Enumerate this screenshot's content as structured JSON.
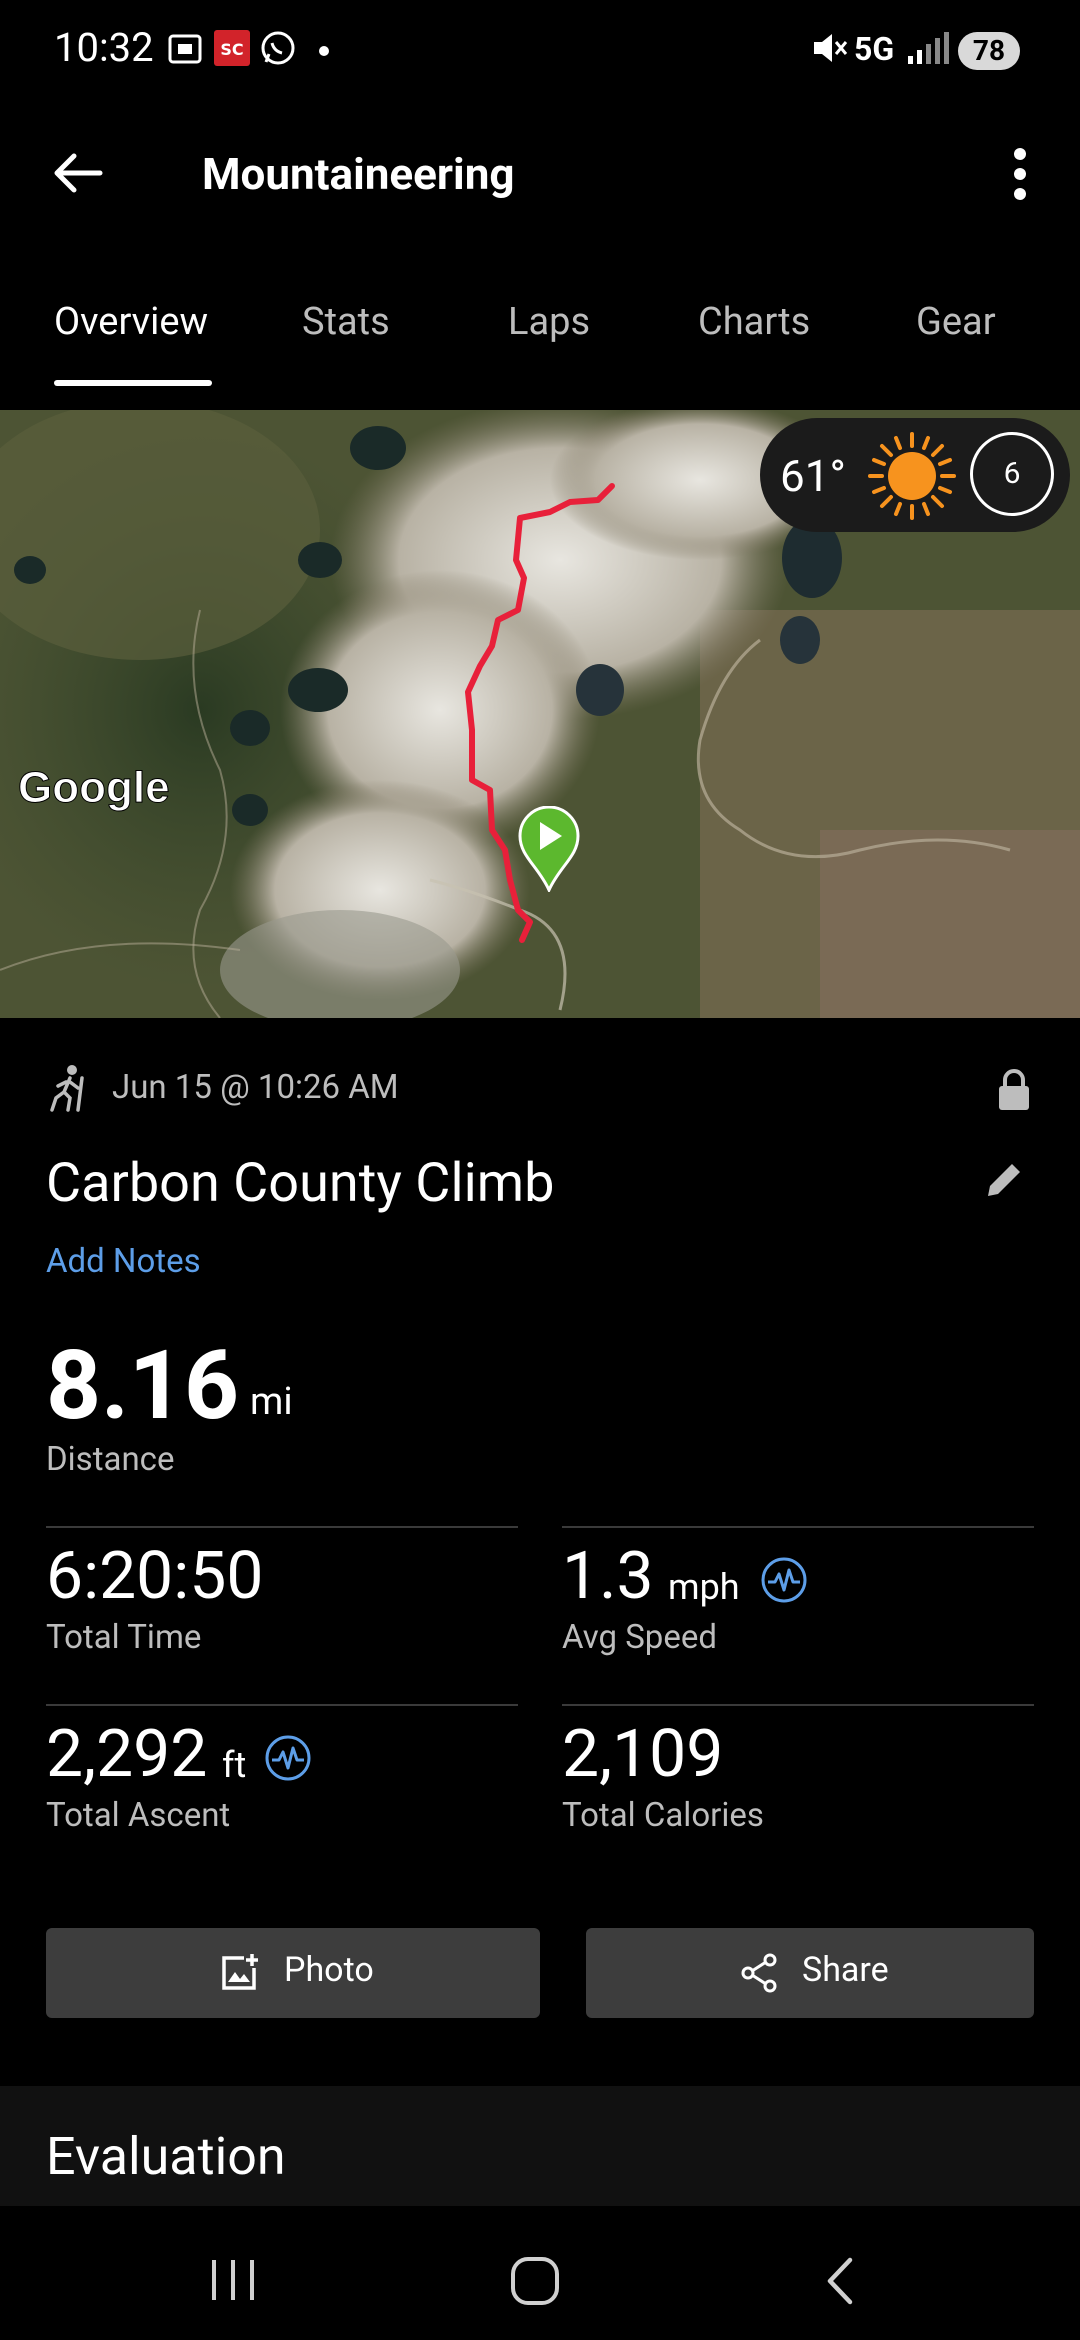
{
  "status_bar": {
    "time": "10:32",
    "network": "5G",
    "battery": "78"
  },
  "app_bar": {
    "title": "Mountaineering"
  },
  "tabs": [
    {
      "label": "Overview",
      "active": true
    },
    {
      "label": "Stats",
      "active": false
    },
    {
      "label": "Laps",
      "active": false
    },
    {
      "label": "Charts",
      "active": false
    },
    {
      "label": "Gear",
      "active": false
    }
  ],
  "map": {
    "attribution": "Google",
    "route_color": "#e8203a",
    "weather": {
      "temperature": "61°",
      "moon_phase_value": "6"
    }
  },
  "activity": {
    "date": "Jun 15 @ 10:26 AM",
    "name": "Carbon County Climb",
    "add_notes_label": "Add Notes"
  },
  "stats": {
    "distance": {
      "value": "8.16",
      "unit": "mi",
      "label": "Distance"
    },
    "total_time": {
      "value": "6:20:50",
      "label": "Total Time"
    },
    "avg_speed": {
      "value": "1.3",
      "unit": "mph",
      "label": "Avg Speed"
    },
    "total_ascent": {
      "value": "2,292",
      "unit": "ft",
      "label": "Total Ascent"
    },
    "total_calories": {
      "value": "2,109",
      "label": "Total Calories"
    }
  },
  "buttons": {
    "photo": "Photo",
    "share": "Share"
  },
  "evaluation": {
    "title": "Evaluation"
  },
  "colors": {
    "accent_blue": "#5d9ee8",
    "button_bg": "#3d3d3d",
    "start_marker": "#5cb82e"
  }
}
